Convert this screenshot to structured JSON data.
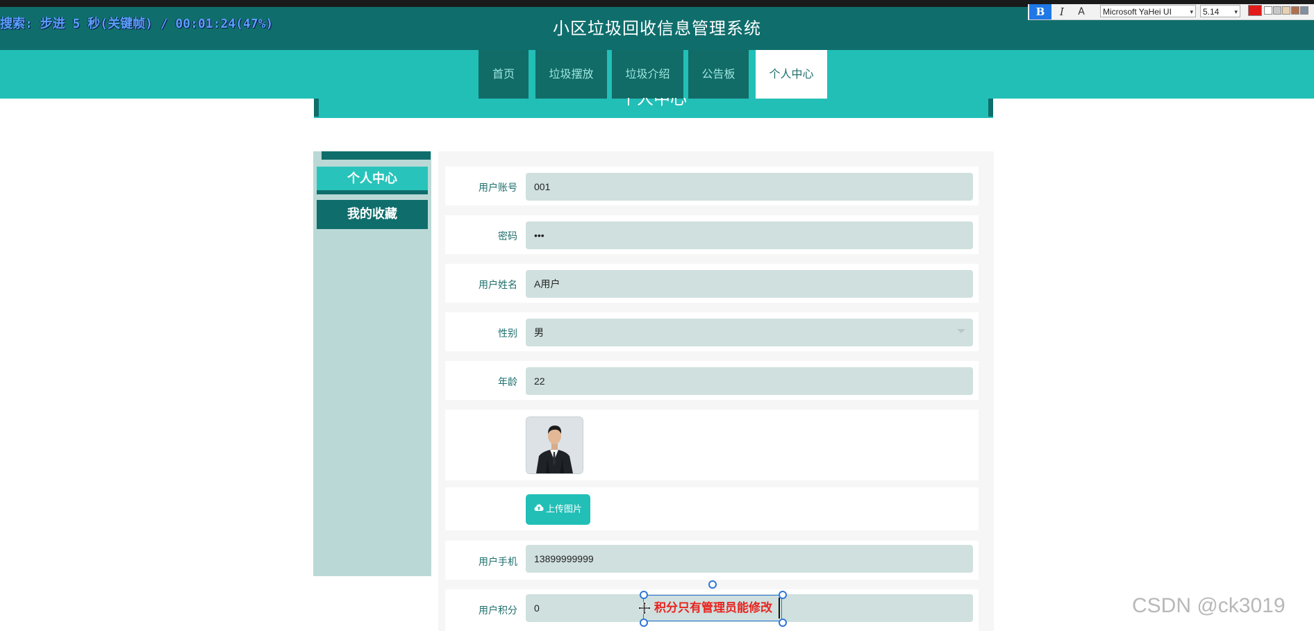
{
  "osd_text": "搜索: 步进 5 秒(关键帧) / 00:01:24(47%)",
  "site": {
    "title": "小区垃圾回收信息管理系统"
  },
  "toolbar": {
    "bold_label": "B",
    "italic_label": "I",
    "font_icon_label": "A",
    "font_family": "Microsoft YaHei UI",
    "font_size": "5.14",
    "swatch_colors": [
      "#e21a1a",
      "#ffffff",
      "#c8c8c8",
      "#e8d1b0",
      "#b07050",
      "#8090a0"
    ]
  },
  "nav": {
    "tabs": [
      {
        "label": "首页",
        "active": false
      },
      {
        "label": "垃圾摆放",
        "active": false
      },
      {
        "label": "垃圾介绍",
        "active": false
      },
      {
        "label": "公告板",
        "active": false
      },
      {
        "label": "个人中心",
        "active": true
      }
    ]
  },
  "page": {
    "banner_title": "个人中心"
  },
  "sidebar": {
    "items": [
      {
        "label": "个人中心",
        "active": true
      },
      {
        "label": "我的收藏",
        "active": false
      }
    ]
  },
  "form": {
    "account": {
      "label": "用户账号",
      "value": "001"
    },
    "password": {
      "label": "密码",
      "value": "•••"
    },
    "name": {
      "label": "用户姓名",
      "value": "A用户"
    },
    "gender": {
      "label": "性别",
      "value": "男"
    },
    "age": {
      "label": "年龄",
      "value": "22"
    },
    "upload": {
      "label": "上传图片"
    },
    "phone": {
      "label": "用户手机",
      "value": "13899999999"
    },
    "points": {
      "label": "用户积分",
      "value": "0"
    }
  },
  "annotation": {
    "text": "积分只有管理员能修改"
  },
  "watermark": "CSDN @ck3019",
  "colors": {
    "header": "#0f6e6c",
    "accent": "#22bfb7",
    "input_bg": "#cfe0de",
    "annotation_red": "#e8231f"
  }
}
